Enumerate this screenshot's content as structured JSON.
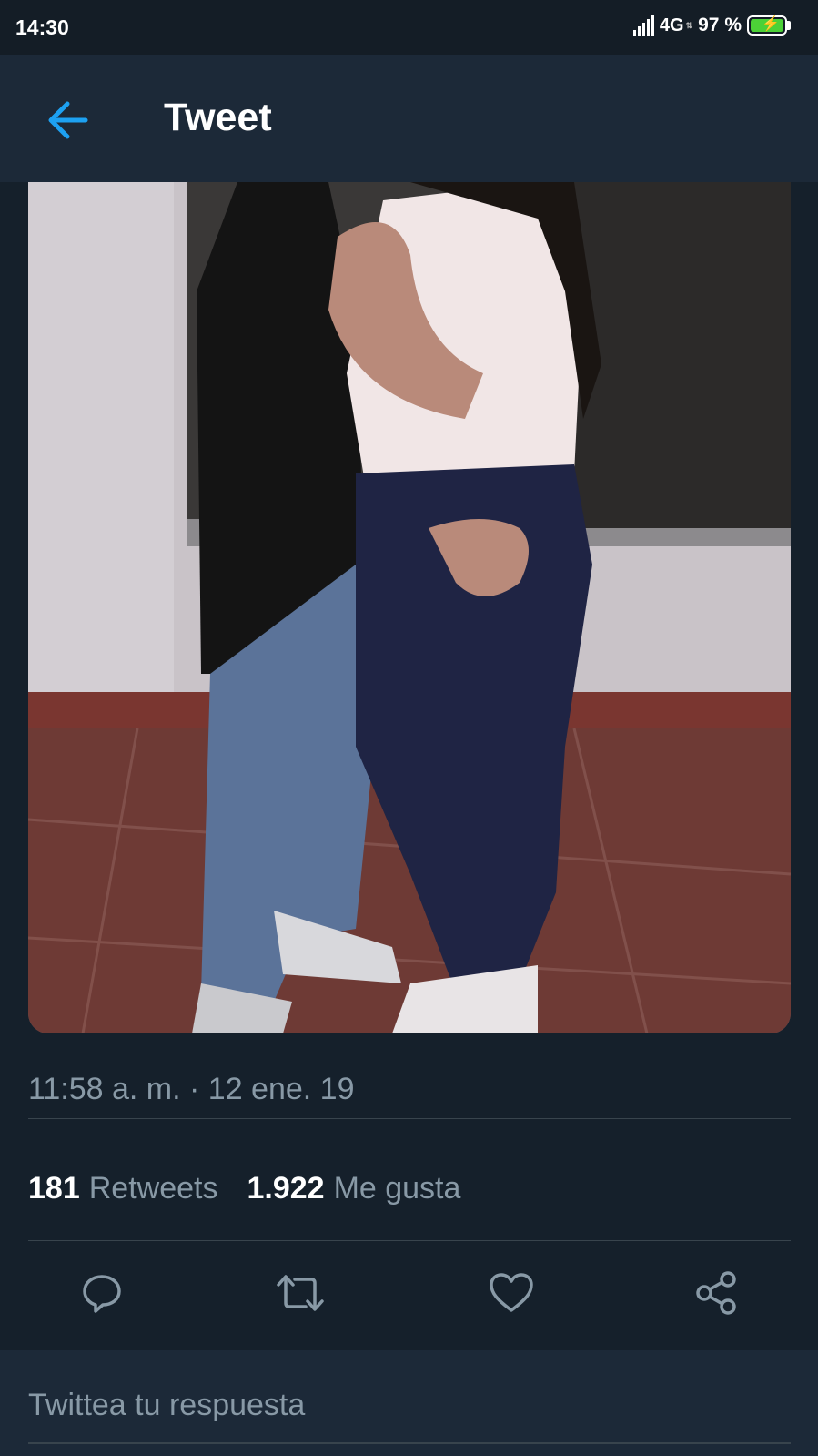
{
  "status_bar": {
    "time": "14:30",
    "network": "4G",
    "battery": "97 %",
    "battery_level": 0.97
  },
  "header": {
    "back_icon": "arrow-left-icon",
    "title": "Tweet"
  },
  "tweet": {
    "media_description_icon": "photo-media",
    "timestamp": "11:58 a. m. · 12 ene. 19",
    "retweets_count": "181",
    "retweets_label": "Retweets",
    "likes_count": "1.922",
    "likes_label": "Me gusta"
  },
  "actions": [
    {
      "icon": "reply-icon"
    },
    {
      "icon": "retweet-icon"
    },
    {
      "icon": "heart-icon"
    },
    {
      "icon": "share-icon"
    }
  ],
  "reply": {
    "placeholder": "Twittea tu respuesta"
  },
  "colors": {
    "background": "#15202b",
    "header": "#1c2938",
    "accent": "#1da1f2",
    "muted_text": "#8899a6",
    "divider": "#38444d"
  }
}
